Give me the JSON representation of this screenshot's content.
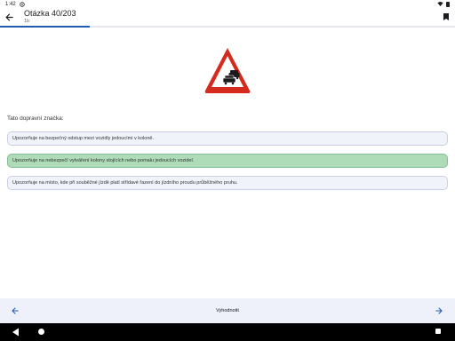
{
  "status_bar": {
    "time": "1:42"
  },
  "header": {
    "title": "Otázka 40/203",
    "subtitle": "1b"
  },
  "progress": {
    "fraction": 0.197
  },
  "question": {
    "text": "Tato dopravní značka:"
  },
  "answers": [
    {
      "text": "Upozorňuje na bezpečný odstup mezi vozidly jedoucími v koloně.",
      "state": "normal"
    },
    {
      "text": "Upozorňuje na nebezpečí vytváření kolony stojících nebo pomalu jedoucích vozidel.",
      "state": "correct"
    },
    {
      "text": "Upozorňuje na místo, kde při souběžné jízdě platí střídavé řazení do jízdního proudu průběžného pruhu.",
      "state": "normal"
    }
  ],
  "bottom_bar": {
    "evaluate_label": "Vyhodnotit"
  },
  "colors": {
    "accent": "#1f5bb5",
    "correct_bg": "#aedbb8",
    "answer_bg": "#f1f3fb",
    "sign_red": "#d52b1e"
  },
  "icons": {
    "back": "arrow-left-icon",
    "bookmark": "bookmark-icon",
    "prev": "arrow-left-icon",
    "next": "arrow-right-icon"
  }
}
